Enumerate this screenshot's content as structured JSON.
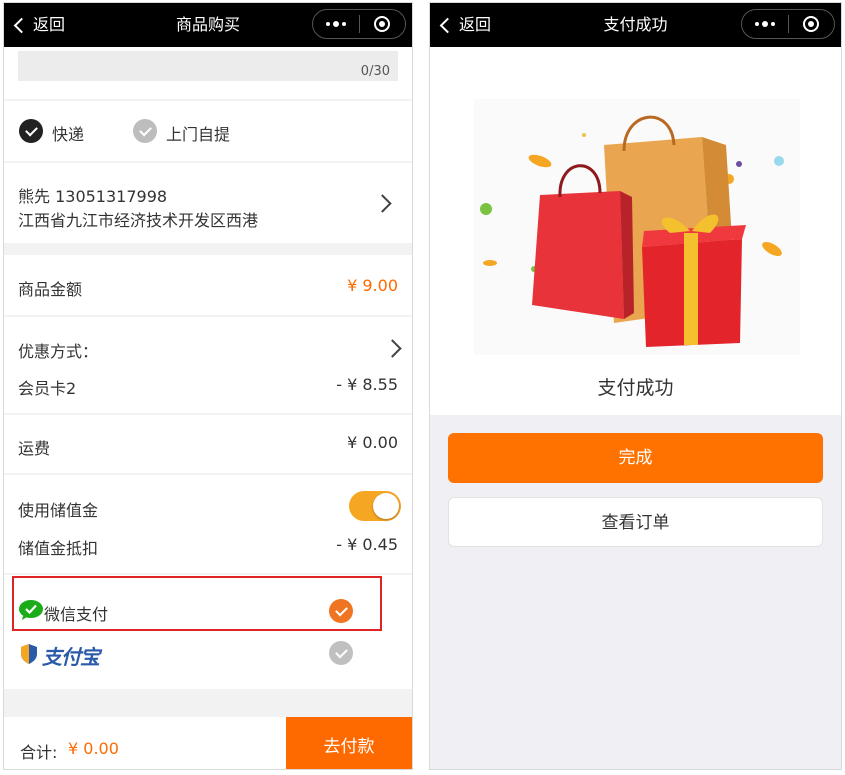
{
  "left": {
    "nav": {
      "back_label": "返回",
      "title": "商品购买"
    },
    "remark": {
      "counter": "0/30"
    },
    "delivery": {
      "options": [
        "快递",
        "上门自提"
      ]
    },
    "address": {
      "contact": "熊先  13051317998",
      "detail": "江西省九江市经济技术开发区西港"
    },
    "goods_amount": {
      "label": "商品金额",
      "value": "¥ 9.00"
    },
    "discount": {
      "label": "优惠方式：",
      "item_label": "会员卡2",
      "item_value": "- ¥ 8.55"
    },
    "shipping": {
      "label": "运费",
      "value": "¥ 0.00"
    },
    "stored_value": {
      "label": "使用储值金",
      "enabled": true,
      "deduct_label": "储值金抵扣",
      "deduct_value": "- ¥ 0.45"
    },
    "payment": {
      "wechat_label": "微信支付",
      "alipay_label": "支付宝",
      "selected": "wechat"
    },
    "footer": {
      "total_label": "合计:",
      "total_value": "¥ 0.00",
      "pay_button": "去付款"
    }
  },
  "right": {
    "nav": {
      "back_label": "返回",
      "title": "支付成功"
    },
    "status_text": "支付成功",
    "done_button": "完成",
    "view_order_button": "查看订单"
  },
  "colors": {
    "accent": "#ff6a00",
    "toggle": "#f5a623",
    "highlight": "#e02424",
    "navbar": "#000000"
  }
}
